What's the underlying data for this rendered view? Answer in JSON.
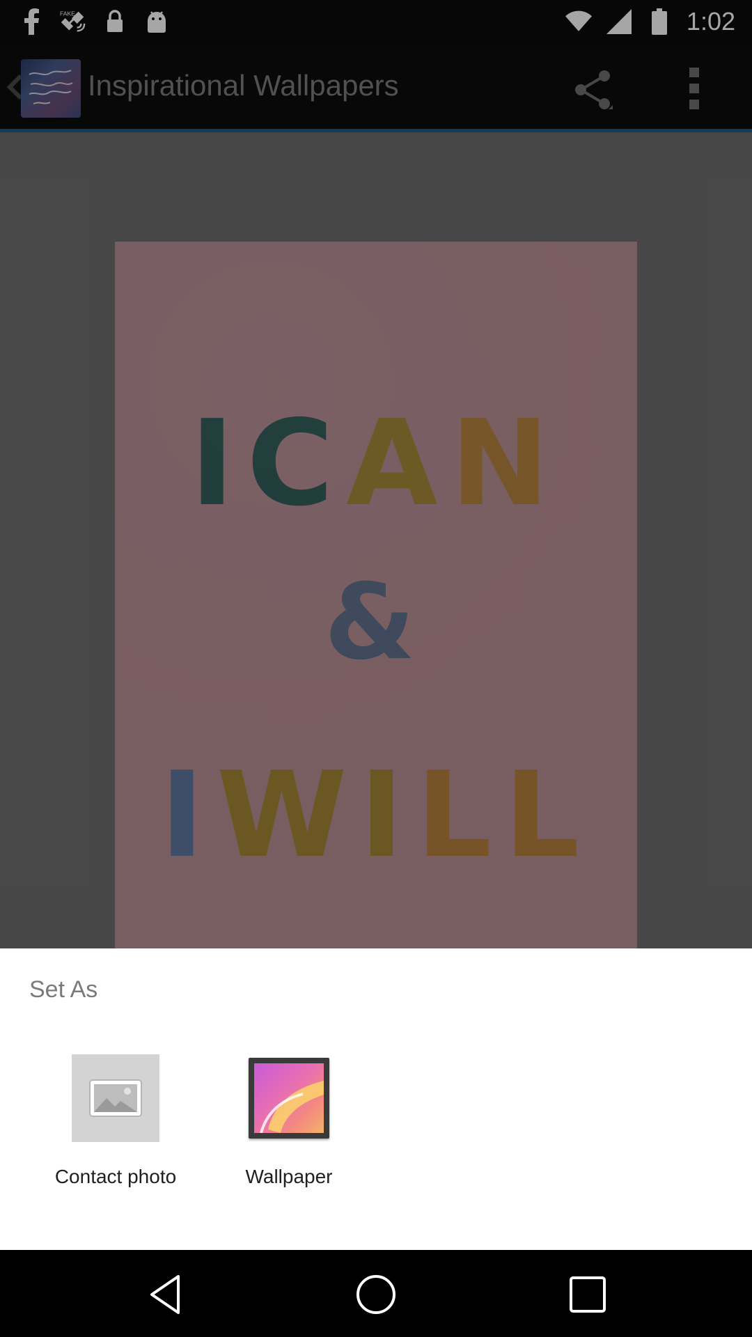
{
  "status_bar": {
    "time": "1:02",
    "icons": [
      "facebook-icon",
      "fake-gps-icon",
      "lock-icon",
      "android-icon",
      "wifi-icon",
      "signal-icon",
      "battery-icon"
    ]
  },
  "app_bar": {
    "title": "Inspirational Wallpapers",
    "icons": [
      "back-chevron-icon",
      "app-thumbnail",
      "share-icon",
      "overflow-menu-icon"
    ],
    "accent_color": "#1d5f86"
  },
  "wallpaper": {
    "line1": [
      "I",
      "C",
      "A",
      "N"
    ],
    "line2": "&",
    "line3": [
      "I",
      "W",
      "I",
      "L",
      "L"
    ]
  },
  "sheet": {
    "title": "Set As",
    "options": [
      {
        "label": "Contact photo",
        "icon": "image-placeholder-icon"
      },
      {
        "label": "Wallpaper",
        "icon": "wallpaper-gallery-icon"
      }
    ]
  },
  "nav_bar": {
    "icons": [
      "back-triangle-icon",
      "home-circle-icon",
      "recent-square-icon"
    ]
  }
}
